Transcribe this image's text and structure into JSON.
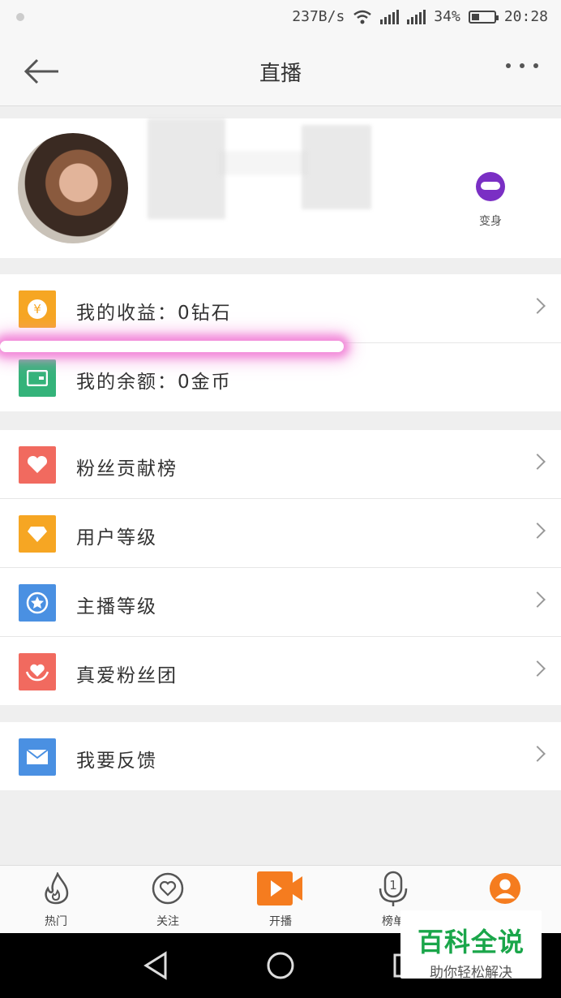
{
  "status_bar": {
    "speed": "237B/s",
    "network": "4G 2G",
    "battery": "34%",
    "battery_level": 0.34,
    "time": "20:28"
  },
  "navbar": {
    "title": "直播"
  },
  "profile": {
    "mask_label": "变身"
  },
  "wallet_group": [
    {
      "label": "我的收益：0钻石",
      "icon": "yen-coin-icon",
      "color": "#f6a623"
    },
    {
      "label": "我的余额：0金币",
      "icon": "wallet-icon",
      "color": "#34b37a"
    }
  ],
  "rank_group": [
    {
      "label": "粉丝贡献榜",
      "icon": "heart-icon",
      "color": "#f16a5f"
    },
    {
      "label": "用户等级",
      "icon": "diamond-tag-icon",
      "color": "#f6a623"
    },
    {
      "label": "主播等级",
      "icon": "star-badge-icon",
      "color": "#4a90e2"
    },
    {
      "label": "真爱粉丝团",
      "icon": "hands-heart-icon",
      "color": "#f16a5f"
    }
  ],
  "feedback_group": [
    {
      "label": "我要反馈",
      "icon": "mail-icon",
      "color": "#4a90e2"
    }
  ],
  "tabbar": [
    {
      "label": "热门",
      "icon": "flame-icon"
    },
    {
      "label": "关注",
      "icon": "heart-outline-icon"
    },
    {
      "label": "开播",
      "icon": "video-play-icon"
    },
    {
      "label": "榜单",
      "icon": "mic-rank-icon"
    },
    {
      "label": "",
      "icon": "user-icon"
    }
  ],
  "watermark": {
    "line1": "百科全说",
    "line2": "助你轻松解决"
  },
  "colors": {
    "accent": "#f57c1f",
    "highlight": "#f28ad9"
  }
}
